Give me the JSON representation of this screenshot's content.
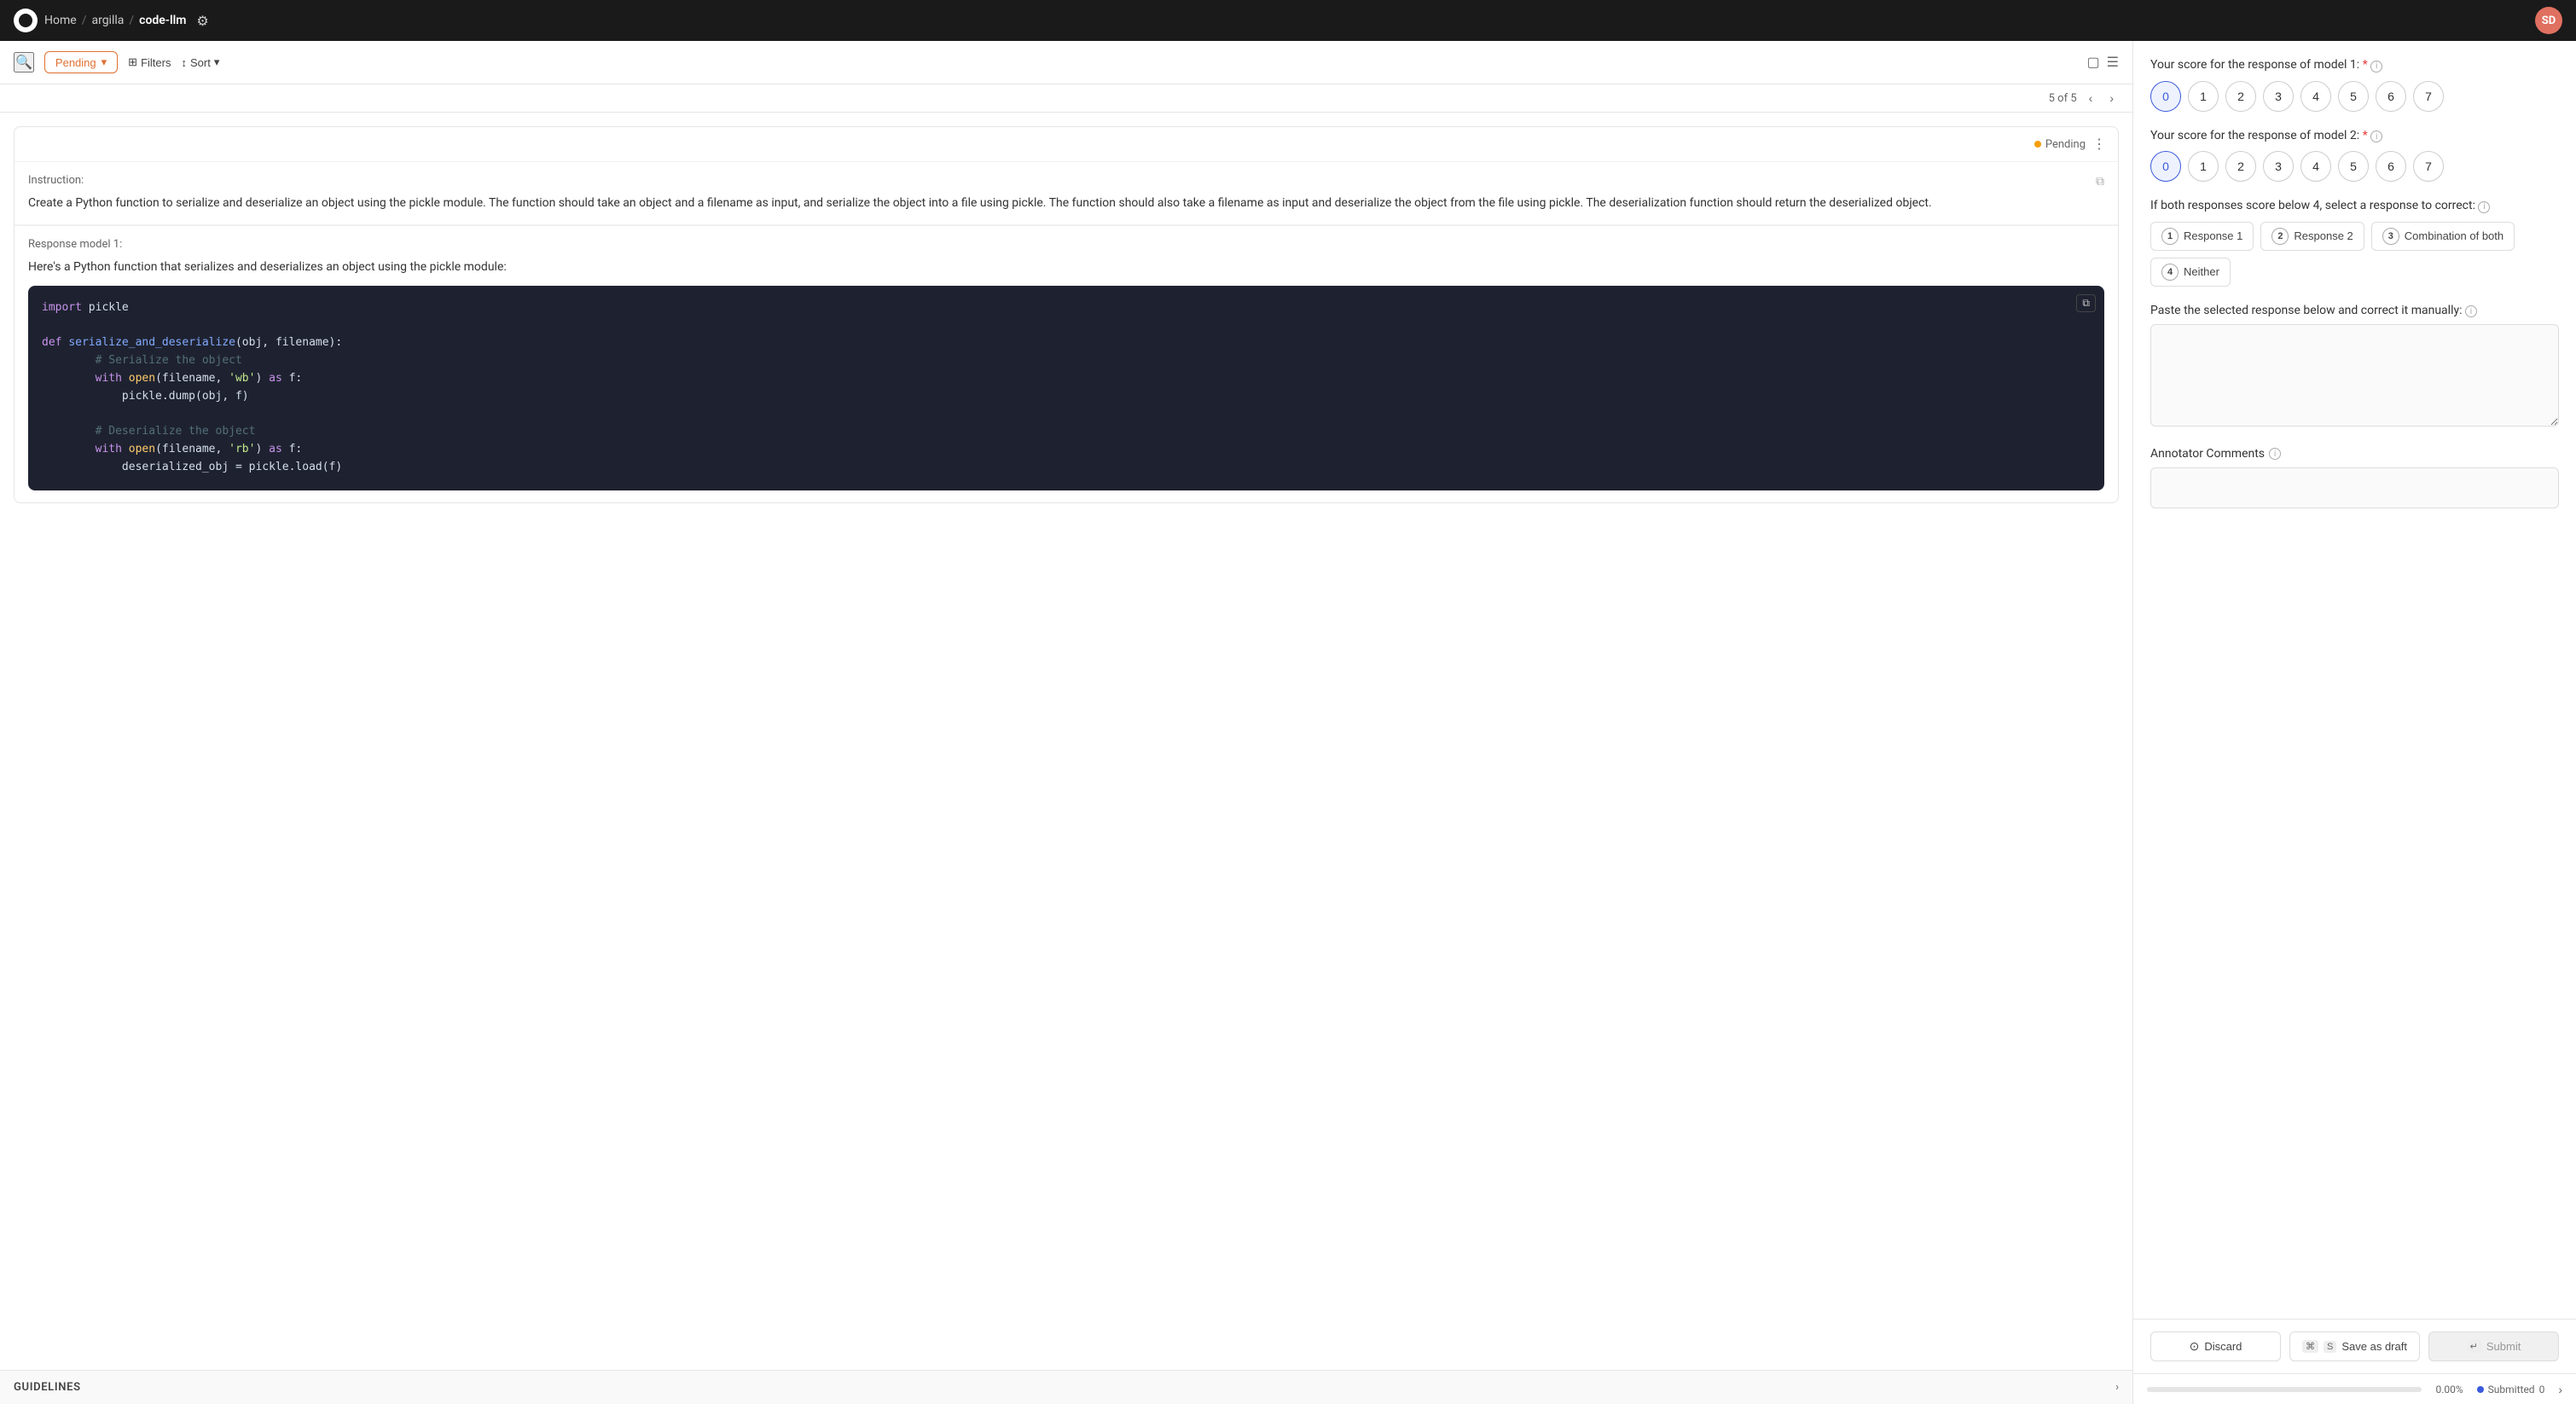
{
  "topnav": {
    "home": "Home",
    "sep1": "/",
    "argilla": "argilla",
    "sep2": "/",
    "repo": "code-llm",
    "avatar": "SD"
  },
  "toolbar": {
    "pending_label": "Pending",
    "filters_label": "Filters",
    "sort_label": "Sort"
  },
  "pagination": {
    "info": "5 of 5"
  },
  "card": {
    "status": "Pending",
    "instruction_label": "Instruction:",
    "instruction_text": "Create a Python function to serialize and deserialize an object using the pickle module. The function should take an object and a filename as input, and serialize the object into a file using pickle. The function should also take a filename as input and deserialize the object from the file using pickle. The deserialization function should return the deserialized object.",
    "response_label": "Response model 1:",
    "response_intro": "Here's a Python function that serializes and deserializes an object using the pickle module:",
    "code_lines": [
      {
        "type": "kw",
        "text": "import"
      },
      {
        "type": "plain",
        "text": " pickle"
      },
      {
        "type": "blank"
      },
      {
        "type": "kw",
        "text": "def"
      },
      {
        "type": "plain",
        "text": " "
      },
      {
        "type": "fn",
        "text": "serialize_and_deserialize"
      },
      {
        "type": "plain",
        "text": "(obj, filename):"
      },
      {
        "type": "cmt",
        "text": "        # Serialize the object"
      },
      {
        "type": "kw2",
        "text": "        with"
      },
      {
        "type": "plain",
        "text": " "
      },
      {
        "type": "builtin",
        "text": "open"
      },
      {
        "type": "plain",
        "text": "(filename, "
      },
      {
        "type": "str",
        "text": "'wb'"
      },
      {
        "type": "plain",
        "text": ") "
      },
      {
        "type": "kw",
        "text": "as"
      },
      {
        "type": "plain",
        "text": " f:"
      },
      {
        "type": "plain",
        "text": "            pickle.dump(obj, f)"
      },
      {
        "type": "blank"
      },
      {
        "type": "cmt",
        "text": "        # Deserialize the object"
      },
      {
        "type": "kw2",
        "text": "        with"
      },
      {
        "type": "plain",
        "text": " "
      },
      {
        "type": "builtin",
        "text": "open"
      },
      {
        "type": "plain",
        "text": "(filename, "
      },
      {
        "type": "str",
        "text": "'rb'"
      },
      {
        "type": "plain",
        "text": ") "
      },
      {
        "type": "kw",
        "text": "as"
      },
      {
        "type": "plain",
        "text": " f:"
      },
      {
        "type": "plain",
        "text": "            deserialized_obj = pickle.load(f)"
      }
    ]
  },
  "guidelines": {
    "label": "GUIDELINES"
  },
  "right_panel": {
    "score1_label": "Your score for the response of model 1:",
    "score1_required": "*",
    "score1_values": [
      "0",
      "1",
      "2",
      "3",
      "4",
      "5",
      "6",
      "7"
    ],
    "score1_active": "0",
    "score2_label": "Your score for the response of model 2:",
    "score2_required": "*",
    "score2_values": [
      "0",
      "1",
      "2",
      "3",
      "4",
      "5",
      "6",
      "7"
    ],
    "score2_active": "0",
    "correct_label": "If both responses score below 4, select a response to correct:",
    "response_options": [
      {
        "num": "1",
        "label": "Response 1"
      },
      {
        "num": "2",
        "label": "Response 2"
      },
      {
        "num": "3",
        "label": "Combination of both"
      },
      {
        "num": "4",
        "label": "Neither"
      }
    ],
    "paste_label": "Paste the selected response below and correct it manually:",
    "comments_label": "Annotator Comments",
    "btn_discard": "Discard",
    "btn_draft": "Save as draft",
    "btn_submit": "Submit",
    "kbd_discard": "⊙",
    "kbd_draft_mod": "⌘",
    "kbd_draft_key": "S",
    "kbd_submit": "↵"
  },
  "status_bar": {
    "progress": "0.00%",
    "submitted_label": "Submitted",
    "submitted_count": "0"
  }
}
